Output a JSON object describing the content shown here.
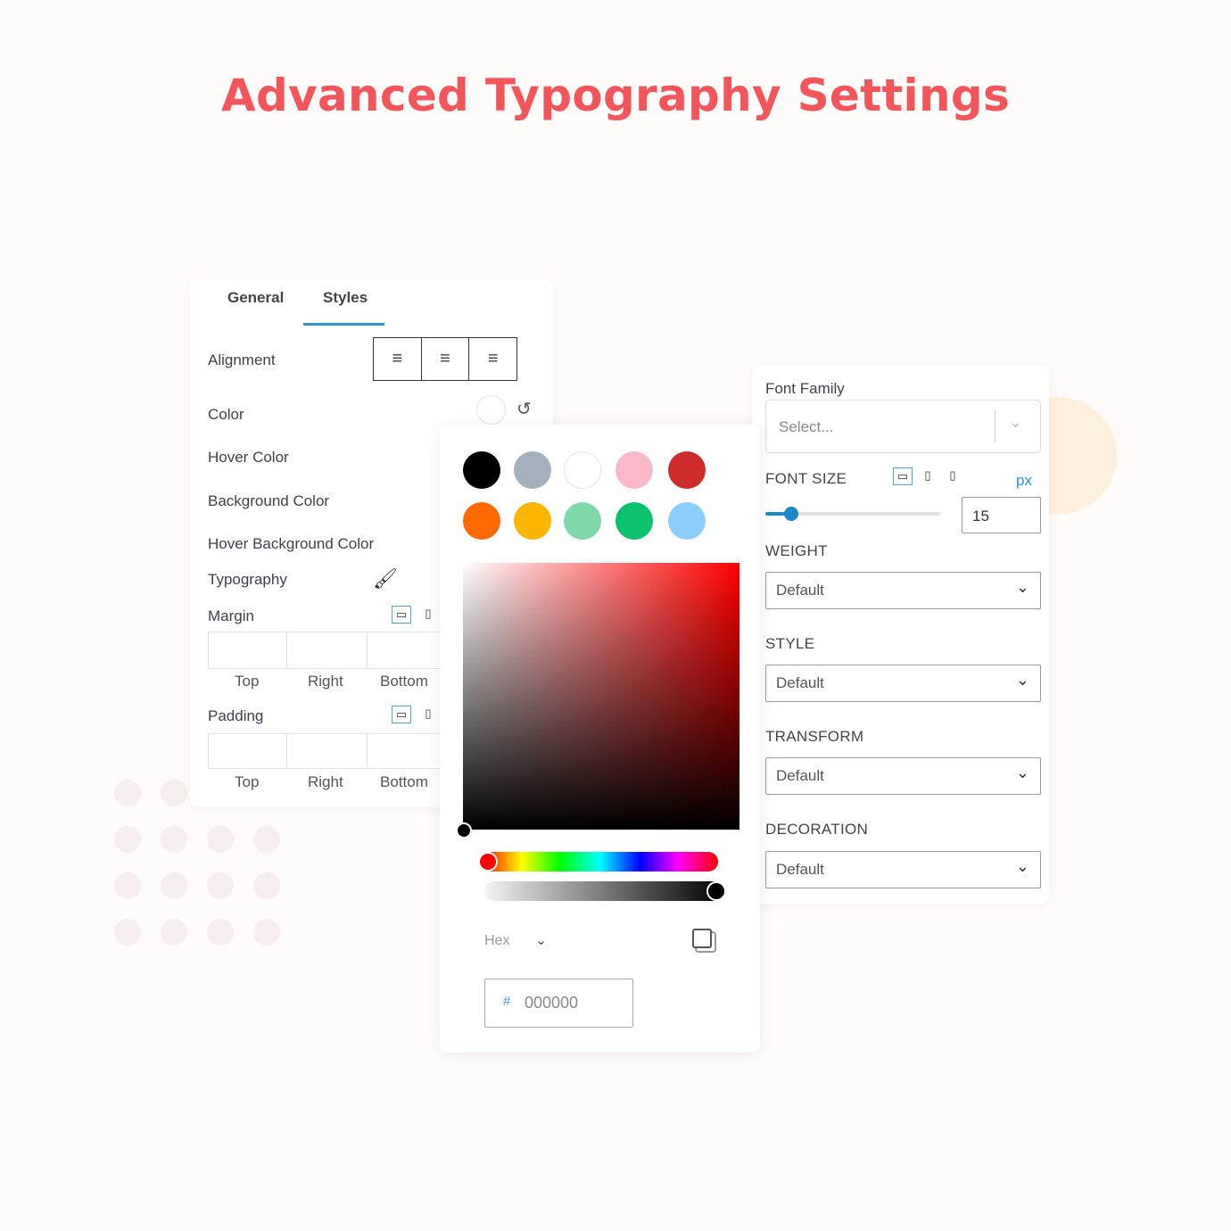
{
  "title": "Advanced Typography Settings",
  "left_panel": {
    "tabs": [
      {
        "label": "General"
      },
      {
        "label": "Styles",
        "active": true
      }
    ],
    "alignment_label": "Alignment",
    "alignment_options": [
      "align-left-icon",
      "align-center-icon",
      "align-right-icon"
    ],
    "rows": [
      "Color",
      "Hover Color",
      "Background Color",
      "Hover Background Color"
    ],
    "typography_label": "Typography",
    "margin": {
      "label": "Margin",
      "sides": [
        "Top",
        "Right",
        "Bottom"
      ]
    },
    "padding": {
      "label": "Padding",
      "sides": [
        "Top",
        "Right",
        "Bottom"
      ]
    }
  },
  "color_picker": {
    "swatches": [
      "#000000",
      "#a4b0bd",
      "#ffffff",
      "#f9b8c8",
      "#d02b2b",
      "#ff6a00",
      "#fbb400",
      "#7ed8a9",
      "#0cc26e",
      "#8ccdfb"
    ],
    "hue": "#ff0000",
    "format_label": "Hex",
    "hash": "#",
    "hex_value": "000000"
  },
  "right_panel": {
    "font_family": {
      "label": "Font Family",
      "placeholder": "Select..."
    },
    "font_size": {
      "label": "FONT SIZE",
      "unit": "px",
      "value": "15",
      "slider_fraction": 0.15
    },
    "weight": {
      "label": "WEIGHT",
      "value": "Default"
    },
    "style": {
      "label": "STYLE",
      "value": "Default"
    },
    "transform": {
      "label": "TRANSFORM",
      "value": "Default"
    },
    "decoration": {
      "label": "DECORATION",
      "value": "Default"
    }
  },
  "colors": {
    "title": "#f4555a",
    "accent": "#1e88c7"
  }
}
